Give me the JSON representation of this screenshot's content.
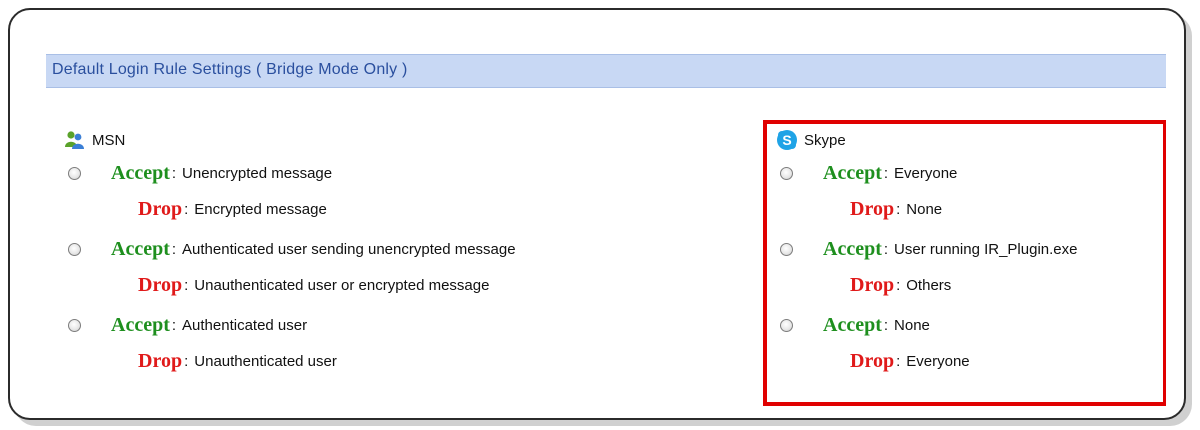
{
  "header": {
    "title": "Default Login Rule Settings ( Bridge Mode Only )"
  },
  "msn": {
    "name": "MSN",
    "icon": "msn-buddy-icon",
    "rules": [
      {
        "accept_label": "Accept",
        "accept_desc": "Unencrypted message",
        "drop_label": "Drop",
        "drop_desc": "Encrypted message"
      },
      {
        "accept_label": "Accept",
        "accept_desc": "Authenticated user sending unencrypted message",
        "drop_label": "Drop",
        "drop_desc": "Unauthenticated user or encrypted message"
      },
      {
        "accept_label": "Accept",
        "accept_desc": "Authenticated user",
        "drop_label": "Drop",
        "drop_desc": "Unauthenticated user"
      }
    ]
  },
  "skype": {
    "name": "Skype",
    "icon": "skype-logo-icon",
    "rules": [
      {
        "accept_label": "Accept",
        "accept_desc": "Everyone",
        "drop_label": "Drop",
        "drop_desc": "None"
      },
      {
        "accept_label": "Accept",
        "accept_desc": "User running IR_Plugin.exe",
        "drop_label": "Drop",
        "drop_desc": "Others"
      },
      {
        "accept_label": "Accept",
        "accept_desc": "None",
        "drop_label": "Drop",
        "drop_desc": "Everyone"
      }
    ]
  },
  "colors": {
    "accept": "#1e8f1e",
    "drop": "#e01a1a",
    "header_bg": "#c8d8f4",
    "highlight": "#e00000"
  },
  "separator": ":"
}
